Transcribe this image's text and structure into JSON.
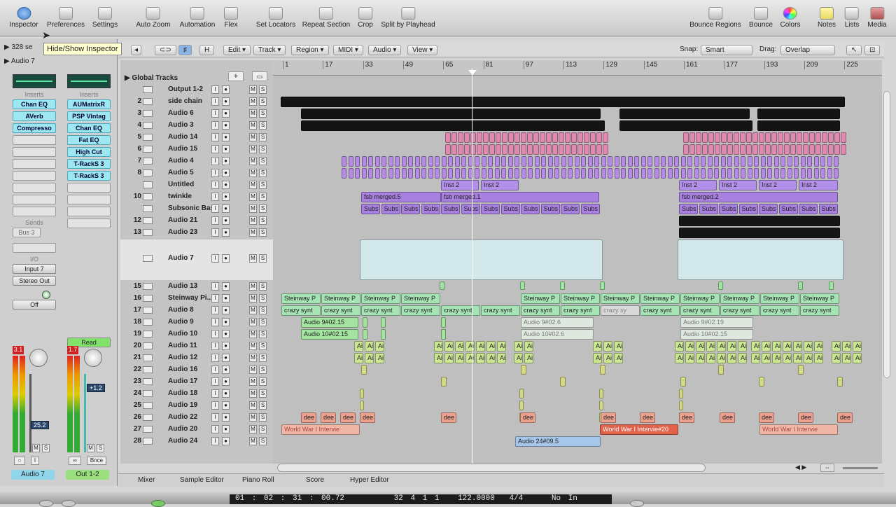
{
  "toolbar": {
    "left": [
      "Inspector",
      "Preferences",
      "Settings",
      "Auto Zoom",
      "Automation",
      "Flex",
      "Set Locators",
      "Repeat Section",
      "Crop",
      "Split by Playhead"
    ],
    "right": [
      "Bounce Regions",
      "Bounce",
      "Colors",
      "Notes",
      "Lists",
      "Media"
    ]
  },
  "tooltip": "Hide/Show Inspector",
  "inspector": {
    "region_row": "328 se",
    "track_row": "Audio 7",
    "inserts_label": "Inserts",
    "left_inserts": [
      "Chan EQ",
      "AVerb",
      "Compresso"
    ],
    "right_inserts": [
      "AUMatrixR",
      "PSP Vintag",
      "Chan EQ",
      "Fat EQ",
      "High Cut",
      "T-RackS 3",
      "T-RackS 3"
    ],
    "sends_label": "Sends",
    "send": "Bus 3",
    "io_label": "I/O",
    "input": "Input 7",
    "output": "Stereo Out",
    "left_auto": "Off",
    "right_auto": "Read",
    "left_peak": "3.1",
    "right_peak": "1.7",
    "left_level": "25.2",
    "right_level": "+1.2",
    "bnce": "Bnce",
    "left_name": "Audio 7",
    "right_name": "Out 1-2"
  },
  "localbar": {
    "menus": [
      "Edit",
      "Track",
      "Region",
      "MIDI",
      "Audio",
      "View"
    ],
    "snap_label": "Snap:",
    "snap_value": "Smart",
    "drag_label": "Drag:",
    "drag_value": "Overlap"
  },
  "global_tracks": "Global Tracks",
  "ruler": [
    "1",
    "17",
    "33",
    "49",
    "65",
    "81",
    "97",
    "113",
    "129",
    "145",
    "161",
    "177",
    "193",
    "209",
    "225"
  ],
  "tracks": [
    {
      "num": "",
      "name": "Output 1-2"
    },
    {
      "num": "2",
      "name": "side chain"
    },
    {
      "num": "3",
      "name": "Audio 6"
    },
    {
      "num": "4",
      "name": "Audio 3"
    },
    {
      "num": "5",
      "name": "Audio 14"
    },
    {
      "num": "6",
      "name": "Audio 15"
    },
    {
      "num": "7",
      "name": "Audio 4"
    },
    {
      "num": "8",
      "name": "Audio 5"
    },
    {
      "num": "",
      "name": "Untitled"
    },
    {
      "num": "10",
      "name": "twinkle"
    },
    {
      "num": "",
      "name": "Subsonic Bass"
    },
    {
      "num": "12",
      "name": "Audio 21"
    },
    {
      "num": "13",
      "name": "Audio 23"
    },
    {
      "num": "",
      "name": "Audio 7"
    },
    {
      "num": "15",
      "name": "Audio 13"
    },
    {
      "num": "16",
      "name": "Steinway Pi..."
    },
    {
      "num": "17",
      "name": "Audio 8"
    },
    {
      "num": "18",
      "name": "Audio 9"
    },
    {
      "num": "19",
      "name": "Audio 10"
    },
    {
      "num": "20",
      "name": "Audio 11"
    },
    {
      "num": "21",
      "name": "Audio 12"
    },
    {
      "num": "22",
      "name": "Audio 16"
    },
    {
      "num": "23",
      "name": "Audio 17"
    },
    {
      "num": "24",
      "name": "Audio 18"
    },
    {
      "num": "25",
      "name": "Audio 19"
    },
    {
      "num": "26",
      "name": "Audio 22"
    },
    {
      "num": "27",
      "name": "Audio 20"
    },
    {
      "num": "28",
      "name": "Audio 24"
    }
  ],
  "regions": {
    "inst": "Inst 2",
    "fsb5": "fsb merged.5",
    "fsb1": "fsb merged.1",
    "fsb2": "fsb merged.2",
    "subs": "Subs",
    "steinway": "Steinway P",
    "crazy": "crazy synt",
    "crazy_muted": "crazy sy",
    "a9a": "Audio 9#02.15",
    "a9b": "Audio 9#02.6",
    "a9c": "Audio 9#02.19",
    "a10a": "Audio 10#02.15",
    "a10b": "Audio 10#02.6",
    "a10c": "Audio 10#02.15",
    "ai": "Ai",
    "dee": "dee",
    "ww1": "World War I Intervie",
    "ww2": "World War I Intervie#20",
    "ww3": "World War I Intervie",
    "a24": "Audio 24#09.5"
  },
  "bottom_tabs": [
    "Mixer",
    "Sample Editor",
    "Piano Roll",
    "Score",
    "Hyper Editor"
  ],
  "transport": {
    "position": "01 : 02 : 31 : 00.72",
    "bars": "32   4   1     1",
    "tempo": "122.0000",
    "signature": "4/4",
    "in": "No In"
  }
}
